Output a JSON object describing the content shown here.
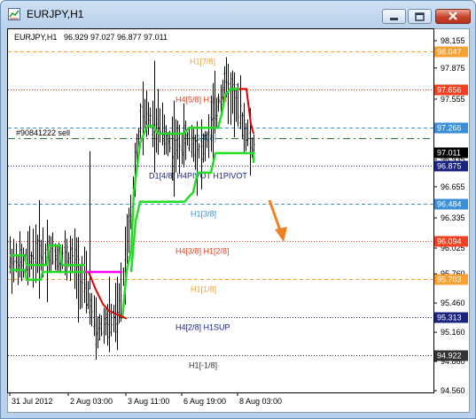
{
  "window": {
    "title": "EURJPY,H1"
  },
  "header": {
    "symbol": "EURJPY,H1",
    "ohlc": "96.929 97.027 96.877 97.011"
  },
  "order_label": "#90841222 sell",
  "price_axis": {
    "ticks": [
      "98.155",
      "97.875",
      "97.555",
      "97.245",
      "96.935",
      "96.655",
      "96.335",
      "96.025",
      "95.760",
      "95.460",
      "95.160",
      "94.860",
      "94.560"
    ]
  },
  "time_axis": {
    "ticks": [
      "31 Jul 2012",
      "2 Aug 03:00",
      "3 Aug 11:00",
      "6 Aug 19:00",
      "8 Aug 03:00"
    ]
  },
  "levels": [
    {
      "label": "H1[7/8]",
      "price": 98.047,
      "tag": "98.047",
      "color": "#f5a030",
      "style": "dash",
      "label_color": "#f5a030"
    },
    {
      "label": "H4[5/8] H1[6/8]",
      "price": 97.656,
      "tag": "97.656",
      "color": "#f04020",
      "style": "dot",
      "label_color": "#e84020"
    },
    {
      "label": "H1[5/8]",
      "price": 97.266,
      "tag": "97.266",
      "color": "#3b8fd8",
      "style": "dash",
      "label_color": "#3b8fd8"
    },
    {
      "label": "D1[4/8] H4PIVOT H1PIVOT",
      "price": 96.875,
      "tag": "96.875",
      "color": "#1a237e",
      "style": "dot",
      "label_color": "#1a237e"
    },
    {
      "label": "H1[3/8]",
      "price": 96.484,
      "tag": "96.484",
      "color": "#3b8fd8",
      "style": "dash",
      "label_color": "#3b8fd8"
    },
    {
      "label": "H4[3/8] H1[2/8]",
      "price": 96.094,
      "tag": "96.094",
      "color": "#f04020",
      "style": "dot",
      "label_color": "#e84020"
    },
    {
      "label": "H1[1/8]",
      "price": 95.703,
      "tag": "95.703",
      "color": "#f5a030",
      "style": "dash",
      "label_color": "#f5a030"
    },
    {
      "label": "H4[2/8] H1SUP",
      "price": 95.313,
      "tag": "95.313",
      "color": "#1a237e",
      "style": "dot",
      "label_color": "#1a237e"
    },
    {
      "label": "H1[-1/8]",
      "price": 94.922,
      "tag": "94.922",
      "color": "#333333",
      "style": "dot",
      "label_color": "#333333"
    }
  ],
  "current_price": {
    "price": 97.011,
    "tag": "97.011"
  },
  "order_line": {
    "price": 97.15,
    "color": "#1f7a3a"
  },
  "colors": {
    "candles": "#000000",
    "green_line": "#22dd22",
    "red_segment": "#e00000",
    "magenta_segment": "#ff00ff",
    "arrow": "#f08020"
  }
}
